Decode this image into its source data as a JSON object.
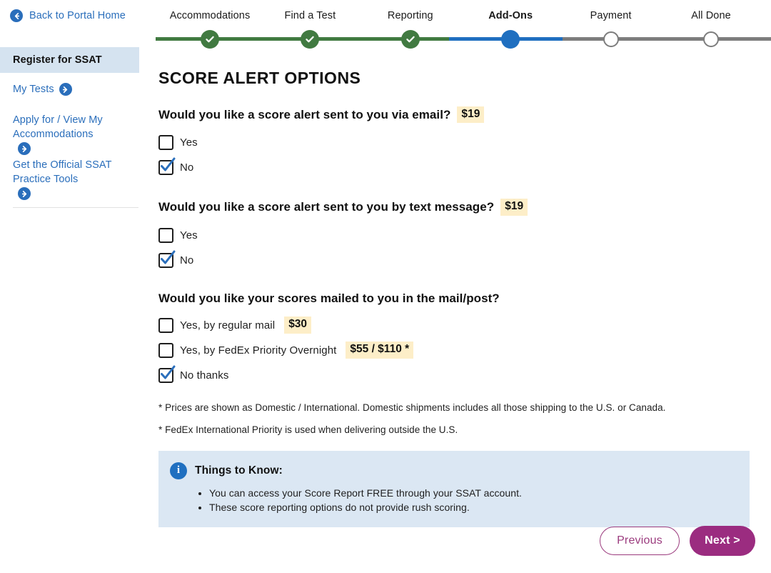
{
  "sidebar": {
    "back_link": {
      "label": "Back to Portal Home",
      "icon": "arrow-left-circle-icon"
    },
    "active_item": {
      "label": "Register for SSAT"
    },
    "links": [
      {
        "label": "My Tests",
        "icon": "arrow-right-circle-icon"
      },
      {
        "label": "Apply for / View My Accommodations",
        "icon": "arrow-right-circle-icon"
      },
      {
        "label": "Get the Official SSAT Practice Tools",
        "icon": "arrow-right-circle-icon"
      }
    ]
  },
  "stepper": {
    "steps": [
      {
        "label": "Accommodations",
        "state": "done"
      },
      {
        "label": "Find a Test",
        "state": "done"
      },
      {
        "label": "Reporting",
        "state": "done"
      },
      {
        "label": "Add-Ons",
        "state": "current"
      },
      {
        "label": "Payment",
        "state": "todo"
      },
      {
        "label": "All Done",
        "state": "todo"
      }
    ],
    "colors": {
      "done": "#417a41",
      "current": "#1f6fc0",
      "todo": "#7d7d7d"
    }
  },
  "main": {
    "title": "SCORE ALERT OPTIONS",
    "questions": [
      {
        "text": "Would you like a score alert sent to you via email?",
        "price": "$19",
        "options": [
          {
            "label": "Yes",
            "checked": false,
            "price": null
          },
          {
            "label": "No",
            "checked": true,
            "price": null
          }
        ]
      },
      {
        "text": "Would you like a score alert sent to you by text message?",
        "price": "$19",
        "options": [
          {
            "label": "Yes",
            "checked": false,
            "price": null
          },
          {
            "label": "No",
            "checked": true,
            "price": null
          }
        ]
      },
      {
        "text": "Would you like your scores mailed to you in the mail/post?",
        "price": null,
        "options": [
          {
            "label": "Yes, by regular mail",
            "checked": false,
            "price": "$30"
          },
          {
            "label": "Yes, by FedEx Priority Overnight",
            "checked": false,
            "price": "$55 / $110 *"
          },
          {
            "label": "No thanks",
            "checked": true,
            "price": null
          }
        ]
      }
    ],
    "footnotes": [
      "* Prices are shown as Domestic / International. Domestic shipments includes all those shipping to the U.S. or Canada.",
      "* FedEx International Priority is used when delivering outside the U.S."
    ],
    "infobox": {
      "icon": "info-circle-icon",
      "icon_glyph": "i",
      "title": "Things to Know:",
      "items": [
        "You can access your Score Report FREE through your SSAT account.",
        "These score reporting options do not provide rush scoring."
      ]
    }
  },
  "nav": {
    "previous_label": "Previous",
    "next_label": "Next >"
  },
  "colors": {
    "link_blue": "#2a6ebb",
    "highlight_yellow": "#fdeec8",
    "sidebar_active_bg": "#d5e3f0",
    "infobox_bg": "#dbe7f3",
    "brand_magenta": "#9b2c80",
    "checkmark_blue": "#2a6ebb"
  }
}
